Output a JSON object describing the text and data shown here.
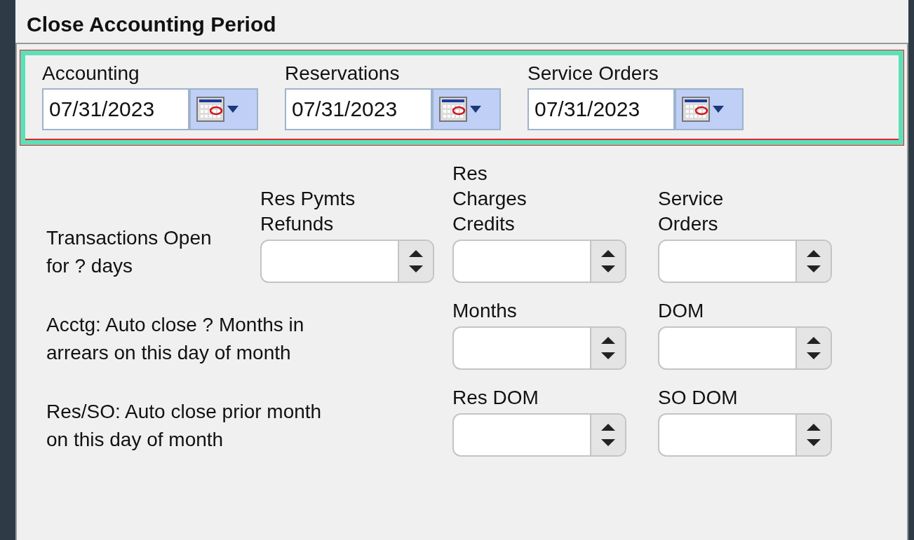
{
  "title": "Close Accounting Period",
  "date_fields": [
    {
      "label": "Accounting",
      "value": "07/31/2023"
    },
    {
      "label": "Reservations",
      "value": "07/31/2023"
    },
    {
      "label": "Service Orders",
      "value": "07/31/2023"
    }
  ],
  "rows": [
    {
      "kind": "triple",
      "label": "Transactions Open for ? days",
      "fields": [
        {
          "header": "Res Pymts Refunds"
        },
        {
          "header": "Res Charges Credits"
        },
        {
          "header": "Service Orders"
        }
      ]
    },
    {
      "kind": "pair",
      "label": "Acctg: Auto close ? Months in arrears on this day of month",
      "fields": [
        {
          "header": "Months"
        },
        {
          "header": "DOM"
        }
      ]
    },
    {
      "kind": "pair",
      "label": "Res/SO: Auto close prior month on this day of month",
      "fields": [
        {
          "header": "Res DOM"
        },
        {
          "header": "SO DOM"
        }
      ]
    }
  ]
}
